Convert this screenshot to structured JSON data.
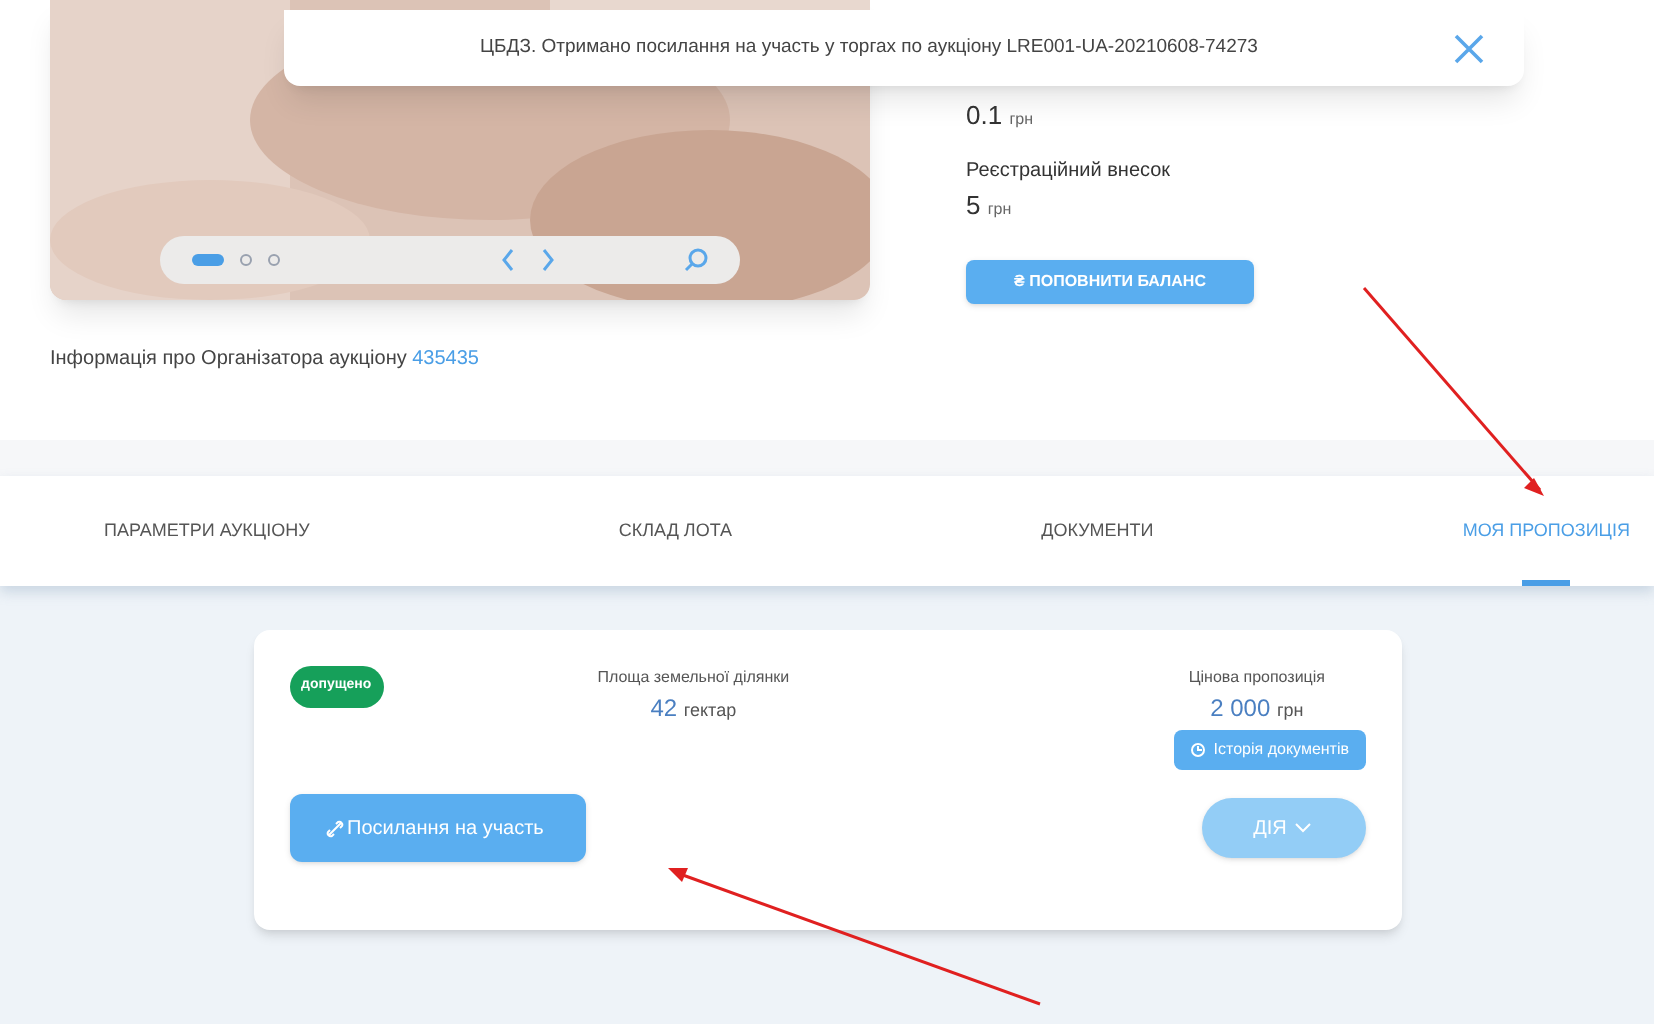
{
  "toast": {
    "message": "ЦБДЗ. Отримано посилання на участь у торгах по аукціону LRE001-UA-20210608-74273"
  },
  "gallery": {
    "dots": [
      {
        "selected": true
      },
      {
        "selected": false
      },
      {
        "selected": false
      }
    ]
  },
  "organizer": {
    "label": "Інформація про Організатора аукціону",
    "link": "435435"
  },
  "fees": [
    {
      "amount": "0.1",
      "unit": "грн"
    },
    {
      "label": "Реєстраційний внесок",
      "amount": "5",
      "unit": "грн"
    }
  ],
  "balance_button": "₴ ПОПОВНИТИ БАЛАНС",
  "tabs": [
    {
      "label": "ПАРАМЕТРИ АУКЦІОНУ",
      "selected": false
    },
    {
      "label": "СКЛАД ЛОТА",
      "selected": false
    },
    {
      "label": "ДОКУМЕНТИ",
      "selected": false
    },
    {
      "label": "МОЯ ПРОПОЗИЦІЯ",
      "selected": true
    }
  ],
  "bid": {
    "status": "допущено",
    "area_label": "Площа земельної ділянки",
    "area_value": "42",
    "area_unit": "гектар",
    "price_label": "Цінова пропозиція",
    "price_value": "2 000",
    "price_unit": "грн",
    "history_button": "Історія документів",
    "link_button": "Посилання на участь",
    "action_button": "ДІЯ"
  }
}
